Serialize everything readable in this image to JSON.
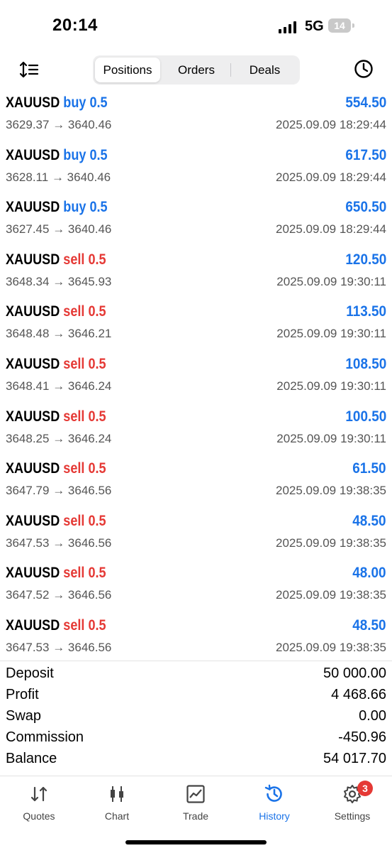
{
  "status_bar": {
    "time": "20:14",
    "network": "5G",
    "battery": "14"
  },
  "tabs": [
    "Positions",
    "Orders",
    "Deals"
  ],
  "positions": [
    {
      "symbol": "XAUUSD",
      "side": "buy",
      "volume": "0.5",
      "open": "3629.37",
      "close": "3640.46",
      "profit": "554.50",
      "time": "2025.09.09 18:29:44"
    },
    {
      "symbol": "XAUUSD",
      "side": "buy",
      "volume": "0.5",
      "open": "3628.11",
      "close": "3640.46",
      "profit": "617.50",
      "time": "2025.09.09 18:29:44"
    },
    {
      "symbol": "XAUUSD",
      "side": "buy",
      "volume": "0.5",
      "open": "3627.45",
      "close": "3640.46",
      "profit": "650.50",
      "time": "2025.09.09 18:29:44"
    },
    {
      "symbol": "XAUUSD",
      "side": "sell",
      "volume": "0.5",
      "open": "3648.34",
      "close": "3645.93",
      "profit": "120.50",
      "time": "2025.09.09 19:30:11"
    },
    {
      "symbol": "XAUUSD",
      "side": "sell",
      "volume": "0.5",
      "open": "3648.48",
      "close": "3646.21",
      "profit": "113.50",
      "time": "2025.09.09 19:30:11"
    },
    {
      "symbol": "XAUUSD",
      "side": "sell",
      "volume": "0.5",
      "open": "3648.41",
      "close": "3646.24",
      "profit": "108.50",
      "time": "2025.09.09 19:30:11"
    },
    {
      "symbol": "XAUUSD",
      "side": "sell",
      "volume": "0.5",
      "open": "3648.25",
      "close": "3646.24",
      "profit": "100.50",
      "time": "2025.09.09 19:30:11"
    },
    {
      "symbol": "XAUUSD",
      "side": "sell",
      "volume": "0.5",
      "open": "3647.79",
      "close": "3646.56",
      "profit": "61.50",
      "time": "2025.09.09 19:38:35"
    },
    {
      "symbol": "XAUUSD",
      "side": "sell",
      "volume": "0.5",
      "open": "3647.53",
      "close": "3646.56",
      "profit": "48.50",
      "time": "2025.09.09 19:38:35"
    },
    {
      "symbol": "XAUUSD",
      "side": "sell",
      "volume": "0.5",
      "open": "3647.52",
      "close": "3646.56",
      "profit": "48.00",
      "time": "2025.09.09 19:38:35"
    },
    {
      "symbol": "XAUUSD",
      "side": "sell",
      "volume": "0.5",
      "open": "3647.53",
      "close": "3646.56",
      "profit": "48.50",
      "time": "2025.09.09 19:38:35"
    }
  ],
  "summary": [
    {
      "label": "Deposit",
      "value": "50 000.00"
    },
    {
      "label": "Profit",
      "value": "4 468.66"
    },
    {
      "label": "Swap",
      "value": "0.00"
    },
    {
      "label": "Commission",
      "value": "-450.96"
    },
    {
      "label": "Balance",
      "value": "54 017.70"
    }
  ],
  "bottom_nav": [
    {
      "label": "Quotes",
      "icon": "quotes-icon"
    },
    {
      "label": "Chart",
      "icon": "chart-icon"
    },
    {
      "label": "Trade",
      "icon": "trade-icon"
    },
    {
      "label": "History",
      "icon": "history-icon",
      "active": true
    },
    {
      "label": "Settings",
      "icon": "gear-icon",
      "badge": "3"
    }
  ],
  "colors": {
    "buy": "#1a73e8",
    "sell": "#e53935",
    "profit": "#1a73e8",
    "active_tab": "#1a73e8"
  }
}
